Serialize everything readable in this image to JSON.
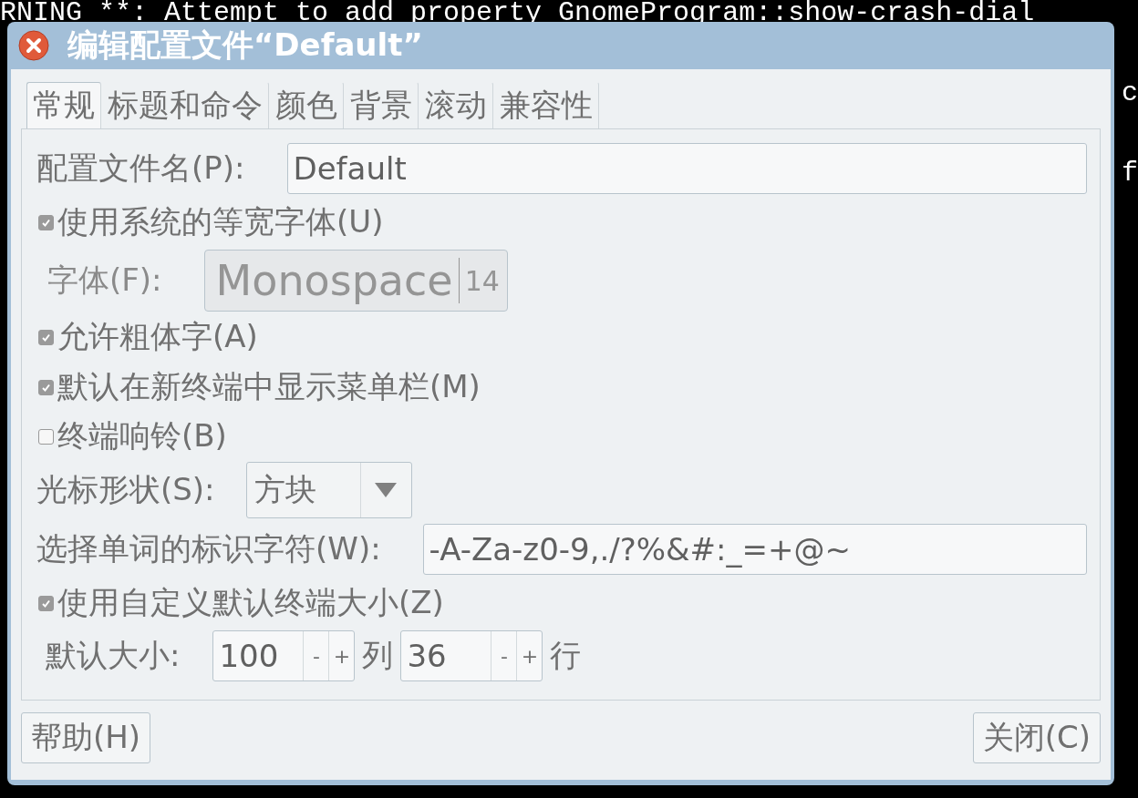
{
  "terminal": {
    "lines": [
      {
        "left": "RNING **:  Attempt to add property GnomeProgram::show-crash-dial"
      },
      {
        "right": "c"
      },
      {
        "right": "f"
      }
    ]
  },
  "dialog": {
    "title": "编辑配置文件“Default”",
    "tabs": [
      {
        "label": "常规",
        "selected": true
      },
      {
        "label": "标题和命令",
        "selected": false
      },
      {
        "label": "颜色",
        "selected": false
      },
      {
        "label": "背景",
        "selected": false
      },
      {
        "label": "滚动",
        "selected": false
      },
      {
        "label": "兼容性",
        "selected": false
      }
    ],
    "rows": [
      {
        "kind": "entry",
        "label": "配置文件名(P):",
        "value": "Default"
      },
      {
        "kind": "check",
        "label": "使用系统的等宽字体(U)",
        "checked": true
      },
      {
        "kind": "font",
        "label": "字体(F):",
        "font": "Monospace",
        "size": "14",
        "disabled": true
      },
      {
        "kind": "check",
        "label": "允许粗体字(A)",
        "checked": true
      },
      {
        "kind": "check",
        "label": "默认在新终端中显示菜单栏(M)",
        "checked": true
      },
      {
        "kind": "check",
        "label": "终端响铃(B)",
        "checked": false
      },
      {
        "kind": "combo",
        "label": "光标形状(S):",
        "value": "方块"
      },
      {
        "kind": "entry",
        "label": "选择单词的标识字符(W):",
        "value": "-A-Za-z0-9,./?%&#:_=+@~"
      },
      {
        "kind": "check",
        "label": "使用自定义默认终端大小(Z)",
        "checked": true
      },
      {
        "kind": "size",
        "label": "默认大小:",
        "spinners": [
          {
            "value": "100",
            "minus": "-",
            "plus": "+",
            "unit": "列"
          },
          {
            "value": "36",
            "minus": "-",
            "plus": "+",
            "unit": "行"
          }
        ]
      }
    ],
    "buttons": {
      "help": "帮助(H)",
      "close": "关闭(C)"
    }
  }
}
